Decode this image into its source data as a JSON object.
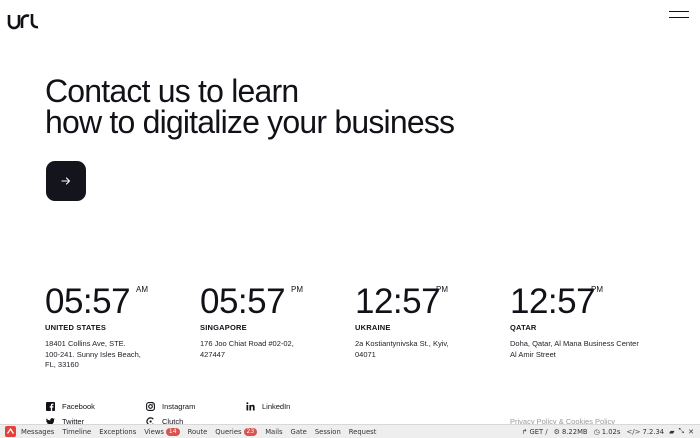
{
  "header": {
    "logo_text": "urt",
    "menu_icon": "hamburger-icon"
  },
  "hero": {
    "line1": "Contact us to learn",
    "line2": "how to digitalize your business",
    "cta_icon": "arrow-right-icon"
  },
  "offices": [
    {
      "time": "05:57",
      "ampm": "AM",
      "country": "UNITED STATES",
      "address1": "18401 Collins Ave, STE.",
      "address2": "100-241. Sunny Isles Beach,",
      "address3": "FL, 33160"
    },
    {
      "time": "05:57",
      "ampm": "PM",
      "country": "SINGAPORE",
      "address1": "176 Joo Chiat Road #02-02,",
      "address2": "427447",
      "address3": ""
    },
    {
      "time": "12:57",
      "ampm": "PM",
      "country": "UKRAINE",
      "address1": "2a Kostiantynivska St., Kyiv,",
      "address2": "04071",
      "address3": ""
    },
    {
      "time": "12:57",
      "ampm": "PM",
      "country": "QATAR",
      "address1": "Doha, Qatar, Al Mana Business Center",
      "address2": "Al Amir Street",
      "address3": ""
    }
  ],
  "social": {
    "facebook": "Facebook",
    "instagram": "Instagram",
    "linkedin": "LinkedIn",
    "twitter": "Twitter",
    "clutch": "Clutch"
  },
  "footer": {
    "privacy": "Privacy Policy & Cookies Policy"
  },
  "debugbar": {
    "tabs": {
      "messages": "Messages",
      "timeline": "Timeline",
      "exceptions": "Exceptions",
      "views": "Views",
      "views_count": "14",
      "route": "Route",
      "queries": "Queries",
      "queries_count": "23",
      "mails": "Mails",
      "gate": "Gate",
      "session": "Session",
      "request": "Request"
    },
    "method": "GET /",
    "memory": "8.22MB",
    "duration": "1.02s",
    "php_version": "7.2.34",
    "badge_color": "#d9534f"
  }
}
